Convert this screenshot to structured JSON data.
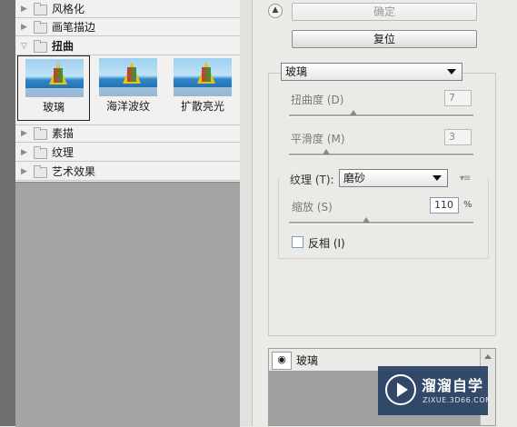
{
  "filter_tree": {
    "categories_top": [
      {
        "label": "风格化",
        "expanded": false
      },
      {
        "label": "画笔描边",
        "expanded": false
      },
      {
        "label": "扭曲",
        "expanded": true
      }
    ],
    "thumbnails": [
      {
        "label": "玻璃",
        "selected": true
      },
      {
        "label": "海洋波纹",
        "selected": false
      },
      {
        "label": "扩散亮光",
        "selected": false
      }
    ],
    "categories_bottom": [
      {
        "label": "素描",
        "expanded": false
      },
      {
        "label": "纹理",
        "expanded": false
      },
      {
        "label": "艺术效果",
        "expanded": false
      }
    ]
  },
  "buttons": {
    "ok_label": "确定",
    "reset_label": "复位"
  },
  "settings": {
    "filter_select": "玻璃",
    "distortion_label": "扭曲度 (D)",
    "distortion_value": "7",
    "distortion_level": 0.35,
    "smoothness_label": "平滑度 (M)",
    "smoothness_value": "3",
    "smoothness_level": 0.2,
    "texture_label": "纹理 (T):",
    "texture_select": "磨砂",
    "scale_label": "缩放 (S)",
    "scale_value": "110",
    "scale_unit": "%",
    "scale_level": 0.42,
    "invert_label": "反相 (I)",
    "invert_checked": false
  },
  "layers": {
    "row_label": "玻璃"
  },
  "watermark": {
    "title": "溜溜自学",
    "url": "ZIXUE.3D66.COM"
  },
  "colors": {
    "watermark_bg": "#284064",
    "panel_bg": "#ecebe8",
    "gray_area": "#a4a4a4"
  }
}
